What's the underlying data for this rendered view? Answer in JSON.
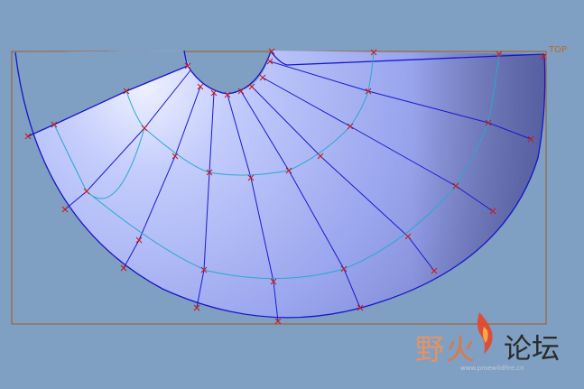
{
  "viewport": {
    "view_label": "TOP",
    "background_color": "#7f9fc3",
    "frame_color": "#a0643a"
  },
  "model": {
    "surface": "half-annulus-dome",
    "shade_light": "#d9e0ff",
    "shade_mid": "#9aa7ee",
    "shade_dark": "#5a64a8",
    "edge_color": "#1717c8",
    "isoline_color": "#27a9cf",
    "point_marker": "x-mark",
    "point_color": "#c81a1a"
  },
  "watermark": {
    "chars": [
      "野",
      "火",
      "论坛"
    ],
    "url": "www.proewildfire.cn",
    "logo": "flame-icon",
    "colors": {
      "ye": "#f0925a",
      "huo": "#e8743a",
      "forum": "#2b2b2b"
    }
  }
}
